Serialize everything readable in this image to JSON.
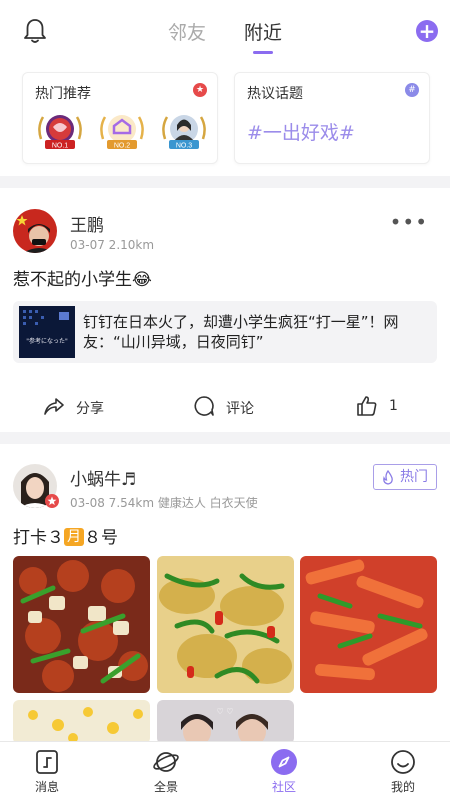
{
  "header": {
    "tabs": [
      "邻友",
      "附近"
    ],
    "active_tab": "附近"
  },
  "hot_card": {
    "title": "热门推荐",
    "medals": [
      {
        "rank": "NO.1",
        "color": "#d63b3b"
      },
      {
        "rank": "NO.2",
        "color": "#e5a63a"
      },
      {
        "rank": "NO.3",
        "color": "#4aa3d8"
      }
    ]
  },
  "topic_card": {
    "title": "热议话题",
    "topic": "#一出好戏#"
  },
  "post1": {
    "username": "王鹏",
    "meta": "03-07 2.10km",
    "content": "惹不起的小学生😂",
    "share_title": "钉钉在日本火了，却遭小学生疯狂“打一星”！网友：“山川异域，日夜同钉”",
    "share_thumb_text": "\"参考になった\"",
    "actions": {
      "share": "分享",
      "comment": "评论",
      "likes": "1"
    }
  },
  "post2": {
    "username": "小蜗牛♬",
    "meta": "03-08 7.54km 健康达人 白衣天使",
    "hot_label": "热门",
    "content_prefix": "打卡３",
    "content_month_glyph": "月",
    "content_suffix": "８号"
  },
  "bottom_nav": [
    {
      "label": "消息",
      "icon": "message-icon"
    },
    {
      "label": "全景",
      "icon": "planet-icon"
    },
    {
      "label": "社区",
      "icon": "compass-icon"
    },
    {
      "label": "我的",
      "icon": "smiley-icon"
    }
  ],
  "colors": {
    "accent": "#8b6cf0",
    "red_badge": "#e64a4a",
    "topic_text": "#9b8cea"
  }
}
